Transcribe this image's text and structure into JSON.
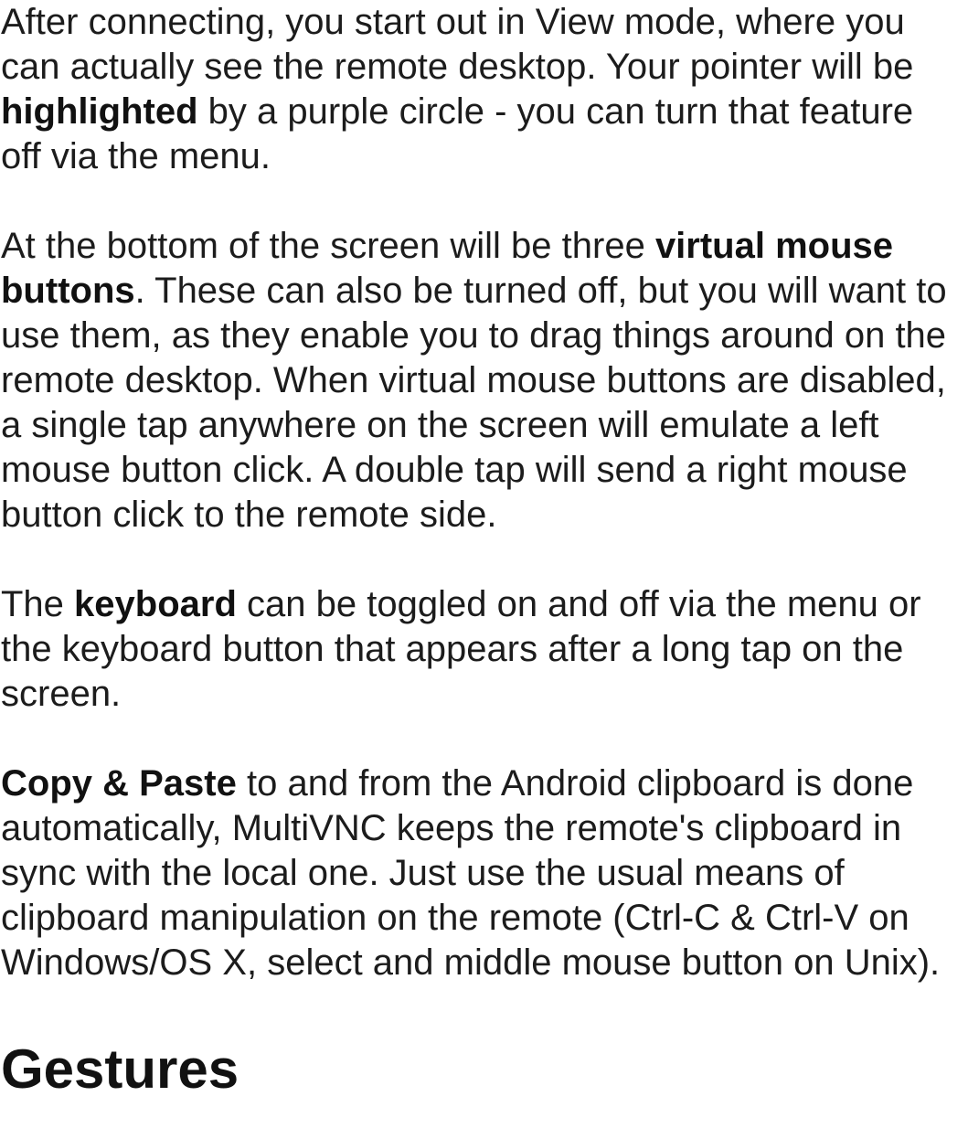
{
  "paragraphs": [
    {
      "a": "After connecting, you start out in View mode, where you can actually see the remote desktop. Your pointer will be ",
      "b": "highlighted",
      "c": " by a purple circle - you can turn that feature off via the menu."
    },
    {
      "a": "At the bottom of the screen will be three ",
      "b": "virtual mouse buttons",
      "c": ". These can also be turned off, but you will want to use them, as they enable you to drag things around on the remote desktop. When virtual mouse buttons are disabled, a single tap anywhere on the screen will emulate a left mouse button click. A double tap will send a right mouse button click to the remote side."
    },
    {
      "a": "The ",
      "b": "keyboard",
      "c": " can be toggled on and off via the menu or the keyboard button that appears after a long tap on the screen."
    },
    {
      "a": "",
      "b": "Copy & Paste",
      "c": " to and from the Android clipboard is done automatically, MultiVNC keeps the remote's clipboard in sync with the local one. Just use the usual means of clipboard manipulation on the remote (Ctrl-C & Ctrl-V on Windows/OS X, select and middle mouse button on Unix)."
    }
  ],
  "heading": "Gestures"
}
